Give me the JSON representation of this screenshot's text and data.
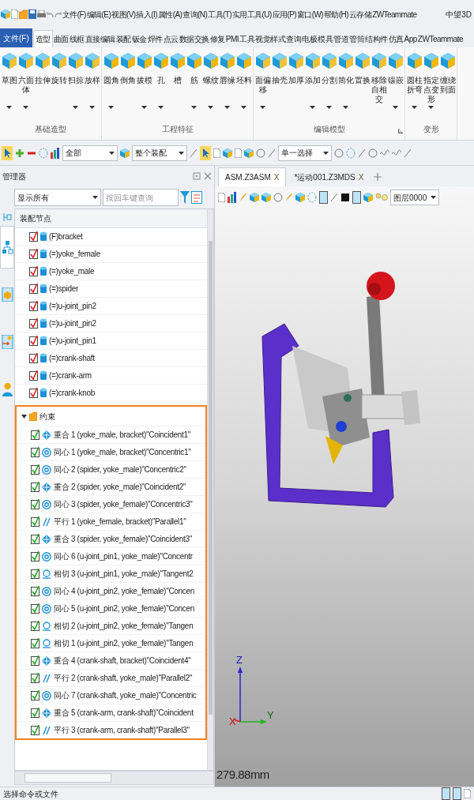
{
  "menu_bar": {
    "items": [
      "文件(F)",
      "编辑(E)",
      "视图(V)",
      "插入(I)",
      "属性(A)",
      "查询(N)",
      "工具(T)",
      "实用工具(U)",
      "应用(P)",
      "窗口(W)",
      "帮助(H)",
      "云存储",
      "ZWTeammate"
    ],
    "brand": "中望3D"
  },
  "ribbon_tabs": [
    {
      "label": "文件(F)",
      "kind": "file",
      "selected": false
    },
    {
      "label": "造型",
      "kind": "tab",
      "selected": true
    },
    {
      "label": "曲面",
      "kind": "tab",
      "selected": false
    },
    {
      "label": "线框",
      "kind": "tab",
      "selected": false
    },
    {
      "label": "直接编辑",
      "kind": "tab",
      "selected": false
    },
    {
      "label": "装配",
      "kind": "tab",
      "selected": false
    },
    {
      "label": "钣金",
      "kind": "tab",
      "selected": false
    },
    {
      "label": "焊件",
      "kind": "tab",
      "selected": false
    },
    {
      "label": "点云",
      "kind": "tab",
      "selected": false
    },
    {
      "label": "数据交换",
      "kind": "tab",
      "selected": false
    },
    {
      "label": "修复",
      "kind": "tab",
      "selected": false
    },
    {
      "label": "PMI",
      "kind": "tab",
      "selected": false
    },
    {
      "label": "工具",
      "kind": "tab",
      "selected": false
    },
    {
      "label": "视觉样式",
      "kind": "tab",
      "selected": false
    },
    {
      "label": "查询",
      "kind": "tab",
      "selected": false
    },
    {
      "label": "电极",
      "kind": "tab",
      "selected": false
    },
    {
      "label": "模具",
      "kind": "tab",
      "selected": false
    },
    {
      "label": "管道",
      "kind": "tab",
      "selected": false
    },
    {
      "label": "管筒",
      "kind": "tab",
      "selected": false
    },
    {
      "label": "结构件",
      "kind": "tab",
      "selected": false
    },
    {
      "label": "仿真",
      "kind": "tab",
      "selected": false
    },
    {
      "label": "App",
      "kind": "tab",
      "selected": false
    },
    {
      "label": "ZWTeammate",
      "kind": "tab",
      "selected": false
    }
  ],
  "ribbon_groups": [
    {
      "title": "基础造型",
      "dialog_launcher": false,
      "buttons": [
        {
          "label": "草图",
          "dropdown": true
        },
        {
          "label": "六面体",
          "dropdown": true
        },
        {
          "label": "拉伸",
          "dropdown": false
        },
        {
          "label": "旋转",
          "dropdown": false
        },
        {
          "label": "扫掠",
          "dropdown": true
        },
        {
          "label": "放样",
          "dropdown": true
        }
      ]
    },
    {
      "title": "工程特征",
      "dialog_launcher": false,
      "buttons": [
        {
          "label": "圆角",
          "dropdown": true
        },
        {
          "label": "倒角",
          "dropdown": false
        },
        {
          "label": "拔模",
          "dropdown": true
        },
        {
          "label": "孔",
          "dropdown": true
        },
        {
          "label": "槽",
          "dropdown": false
        },
        {
          "label": "筋",
          "dropdown": true
        },
        {
          "label": "螺纹",
          "dropdown": true
        },
        {
          "label": "唇缘",
          "dropdown": true
        },
        {
          "label": "坯料",
          "dropdown": true
        }
      ]
    },
    {
      "title": "编辑模型",
      "dialog_launcher": true,
      "buttons": [
        {
          "label": "面偏移",
          "dropdown": true
        },
        {
          "label": "抽壳",
          "dropdown": false
        },
        {
          "label": "加厚",
          "dropdown": false
        },
        {
          "label": "添加",
          "dropdown": true
        },
        {
          "label": "分割",
          "dropdown": true
        },
        {
          "label": "简化",
          "dropdown": true
        },
        {
          "label": "置换",
          "dropdown": false
        },
        {
          "label": "移除自相交",
          "dropdown": false
        },
        {
          "label": "镶嵌",
          "dropdown": true
        }
      ]
    },
    {
      "title": "变形",
      "dialog_launcher": false,
      "buttons": [
        {
          "label": "圆柱折弯",
          "dropdown": true
        },
        {
          "label": "指定点变形",
          "dropdown": true
        },
        {
          "label": "缠绕到面",
          "dropdown": false
        }
      ]
    }
  ],
  "toolbar": {
    "filter_dropdown": "全部",
    "assembly_dropdown": "整个装配",
    "selection_dropdown": "单一选择"
  },
  "manager": {
    "title": "管理器",
    "side_tabs": [
      {
        "kind": "tree",
        "selected": true
      },
      {
        "kind": "part",
        "selected": false
      },
      {
        "kind": "image",
        "selected": false
      },
      {
        "kind": "user",
        "selected": false
      }
    ],
    "display_filter": "显示所有",
    "search": {
      "placeholder": "按回车键查询"
    },
    "tree_header": "装配节点",
    "parts": [
      {
        "label": "(F)bracket",
        "checked": true
      },
      {
        "label": "(=)yoke_female",
        "checked": true
      },
      {
        "label": "(=)yoke_male",
        "checked": true
      },
      {
        "label": "(=)spider",
        "checked": true
      },
      {
        "label": "(=)u-joint_pin2",
        "checked": true
      },
      {
        "label": "(=)u-joint_pin2",
        "checked": true
      },
      {
        "label": "(=)u-joint_pin1",
        "checked": true
      },
      {
        "label": "(=)crank-shaft",
        "checked": true
      },
      {
        "label": "(=)crank-arm",
        "checked": true
      },
      {
        "label": "(=)crank-knob",
        "checked": true
      }
    ],
    "constraints": {
      "label": "约束",
      "expanded": true,
      "items": [
        {
          "label": "重合 1 (yoke_male, bracket)\"Coincident1\"",
          "kind": "coincident",
          "checked": true
        },
        {
          "label": "同心 1 (yoke_male, bracket)\"Concentric1\"",
          "kind": "concentric",
          "checked": true
        },
        {
          "label": "同心 2 (spider, yoke_male)\"Concentric2\"",
          "kind": "concentric",
          "checked": true
        },
        {
          "label": "重合 2 (spider, yoke_male)\"Coincident2\"",
          "kind": "coincident",
          "checked": true
        },
        {
          "label": "同心 3 (spider, yoke_female)\"Concentric3\"",
          "kind": "concentric",
          "checked": true
        },
        {
          "label": "平行 1 (yoke_female, bracket)\"Parallel1\"",
          "kind": "parallel",
          "checked": true
        },
        {
          "label": "重合 3 (spider, yoke_female)\"Coincident3\"",
          "kind": "coincident",
          "checked": true
        },
        {
          "label": "同心 6 (u-joint_pin1, yoke_male)\"Concentr",
          "kind": "concentric",
          "checked": true
        },
        {
          "label": "相切 3 (u-joint_pin1, yoke_male)\"Tangent2",
          "kind": "tangent",
          "checked": true
        },
        {
          "label": "同心 4 (u-joint_pin2, yoke_female)\"Concen",
          "kind": "concentric",
          "checked": true
        },
        {
          "label": "同心 5 (u-joint_pin2, yoke_female)\"Concen",
          "kind": "concentric",
          "checked": true
        },
        {
          "label": "相切 2 (u-joint_pin2, yoke_female)\"Tangen",
          "kind": "tangent",
          "checked": true
        },
        {
          "label": "相切 1 (u-joint_pin2, yoke_female)\"Tangen",
          "kind": "tangent",
          "checked": true
        },
        {
          "label": "重合 4 (crank-shaft, bracket)\"Coincident4\"",
          "kind": "coincident",
          "checked": true
        },
        {
          "label": "平行 2 (crank-shaft, yoke_male)\"Parallel2\"",
          "kind": "parallel",
          "checked": true
        },
        {
          "label": "同心 7 (crank-shaft, yoke_male)\"Concentric",
          "kind": "concentric",
          "checked": true
        },
        {
          "label": "重合 5 (crank-arm, crank-shaft)\"Coincident",
          "kind": "coincident",
          "checked": true
        },
        {
          "label": "平行 3 (crank-arm, crank-shaft)\"Parallel3\"",
          "kind": "parallel",
          "checked": true
        }
      ]
    }
  },
  "document_tabs": [
    {
      "label": "ASM.Z3ASM",
      "close": "X",
      "selected": true
    },
    {
      "label": "*运动001.Z3MDS",
      "close": "X",
      "selected": false
    }
  ],
  "viewport": {
    "layer_dropdown": "图层0000",
    "axes": {
      "x": "X",
      "y": "Y",
      "z": "Z"
    },
    "scale_readout": "279.88mm"
  },
  "status_bar": {
    "message": "选择命令或文件"
  }
}
